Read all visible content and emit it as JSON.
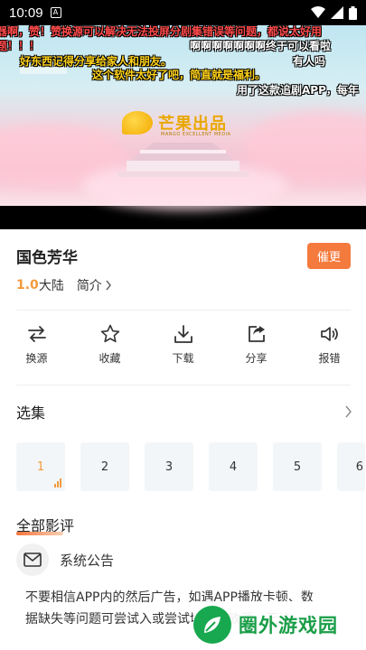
{
  "status_bar": {
    "time": "10:09",
    "notification_icon": "a-app-icon"
  },
  "video": {
    "logo_text": "芒果出品",
    "logo_subtext": "MANGO EXCELLENT MEDIA",
    "danmaku": [
      {
        "text": "器啊，赞！赞换源可以解决无法投屏分剧集错误等问题，都说太好用",
        "color": "#ff4040"
      },
      {
        "text": "题！！！",
        "color": "#ff4040"
      },
      {
        "text": "啊啊啊啊啊啊啊终于可以看啦",
        "color": "#ffffff"
      },
      {
        "text": "好东西记得分享给家人和朋友。",
        "color": "#ffd21a"
      },
      {
        "text": "有人吗",
        "color": "#ffffff"
      },
      {
        "text": "这个软件太好了吧，简直就是福利。",
        "color": "#ffd21a"
      },
      {
        "text": "用了这款追剧APP，每年",
        "color": "#ffffff"
      }
    ]
  },
  "drama": {
    "title": "国色芳华",
    "urge_label": "催更",
    "rating": "1.0",
    "region": "大陆",
    "intro_label": "简介"
  },
  "actions": [
    {
      "label": "换源",
      "icon": "switch-source-icon"
    },
    {
      "label": "收藏",
      "icon": "star-icon"
    },
    {
      "label": "下载",
      "icon": "download-icon"
    },
    {
      "label": "分享",
      "icon": "share-icon"
    },
    {
      "label": "报错",
      "icon": "speaker-icon"
    }
  ],
  "episodes": {
    "title": "选集",
    "items": [
      "1",
      "2",
      "3",
      "4",
      "5",
      "6"
    ],
    "active": "1"
  },
  "comments": {
    "title": "全部影评",
    "notice_name": "系统公告",
    "notice_body": "不要相信APP内的然后广告，如遇APP播放卡顿、数据缺失等问题可尝试入或尝试切换播放源，无法"
  },
  "watermark": {
    "text": "圈外游戏园"
  },
  "colors": {
    "accent": "#f47a3d",
    "rating": "#f29a3d",
    "brand_green": "#1a9e48"
  }
}
